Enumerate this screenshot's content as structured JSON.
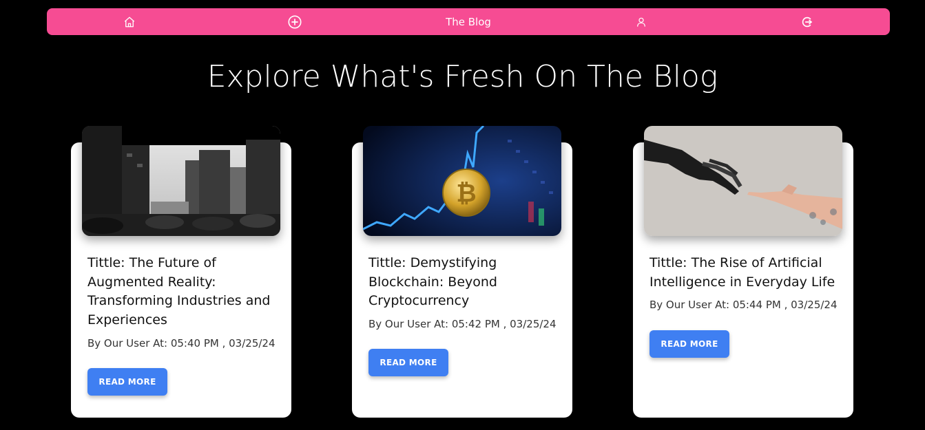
{
  "navbar": {
    "title": "The Blog",
    "icons": [
      "home-icon",
      "plus-circle-icon",
      "user-icon",
      "logout-icon"
    ],
    "color": "#f64c93"
  },
  "headline": "Explore What's Fresh On The Blog",
  "posts": [
    {
      "title": "Tittle: The Future of Augmented Reality: Transforming Industries and Experiences",
      "meta": "By Our User At: 05:40 PM , 03/25/24",
      "button": "READ MORE",
      "image": "city-buildings-bw"
    },
    {
      "title": "Tittle: Demystifying Blockchain: Beyond Cryptocurrency",
      "meta": "By Our User At: 05:42 PM , 03/25/24",
      "button": "READ MORE",
      "image": "bitcoin-chart"
    },
    {
      "title": "Tittle: The Rise of Artificial Intelligence in Everyday Life",
      "meta": "By Our User At: 05:44 PM , 03/25/24",
      "button": "READ MORE",
      "image": "robot-human-hands"
    }
  ],
  "colors": {
    "background": "#000000",
    "card": "#ffffff",
    "button": "#3f7ff2"
  }
}
